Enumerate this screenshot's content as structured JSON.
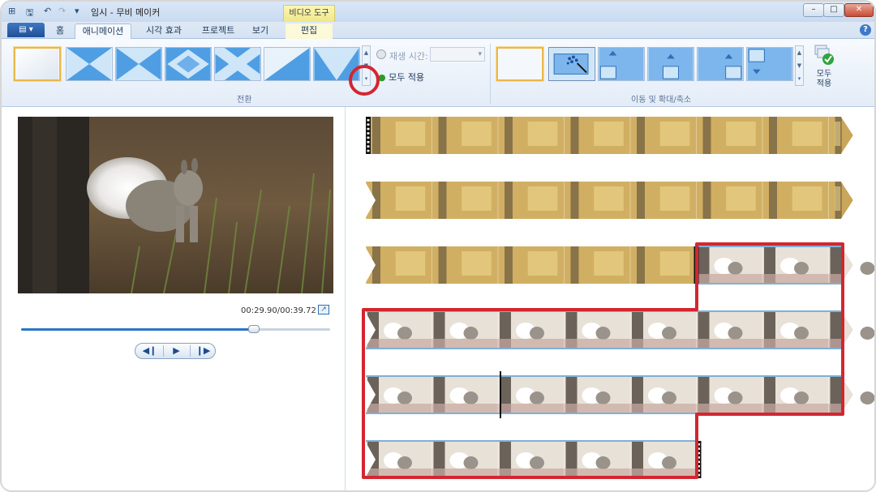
{
  "window": {
    "title": "임시 - 무비 메이커",
    "context_tab_group": "비디오 도구",
    "minimize": "–",
    "maximize": "□",
    "close": "✕"
  },
  "tabs": {
    "app_menu": "▤ ▾",
    "items": [
      "홈",
      "애니메이션",
      "시각 효과",
      "프로젝트",
      "보기",
      "편집"
    ],
    "active": "애니메이션"
  },
  "ribbon": {
    "transitions": {
      "group_label": "전환",
      "duration_label": "재생 시간:",
      "duration_value": "",
      "apply_all_label": "모두 적용",
      "selected_index": 0
    },
    "pan_zoom": {
      "group_label": "이동 및 확대/축소",
      "apply_all_label_line1": "모두",
      "apply_all_label_line2": "적용"
    }
  },
  "preview": {
    "time_current": "00:29.90",
    "time_total": "00:39.72",
    "time_display": "00:29.90/00:39.72",
    "progress": 0.753,
    "controls": {
      "previous": "◀❙",
      "play": "▶",
      "next": "❙▶"
    }
  },
  "storyboard": {
    "forest_clip_color": "#c9a65a",
    "squirrel_clip_color": "#d8cfc4",
    "highlight_color": "#d42630"
  },
  "colors": {
    "accent": "#2b74c9",
    "highlight": "#d42630",
    "ribbon_bg": "#e3ecf7"
  }
}
